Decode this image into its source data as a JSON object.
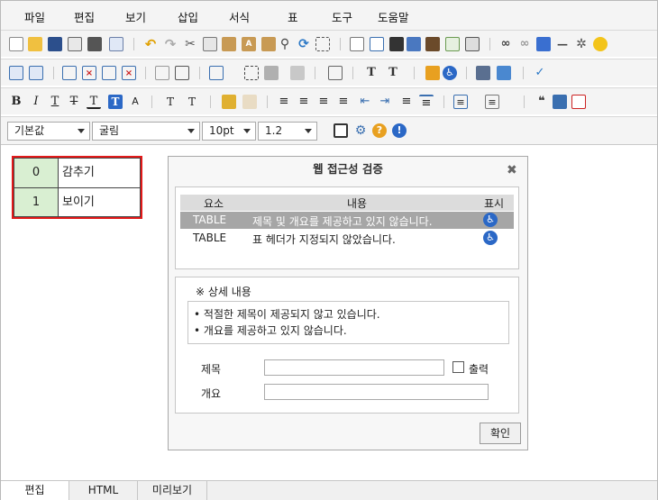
{
  "menu": [
    "파일",
    "편집",
    "보기",
    "삽입",
    "서식",
    "표",
    "도구",
    "도움말"
  ],
  "format_bar": {
    "style_value": "기본값",
    "font_value": "굴림",
    "size_value": "10pt",
    "line_height_value": "1.2"
  },
  "document_table": {
    "rows": [
      {
        "num": "0",
        "label": "감추기"
      },
      {
        "num": "1",
        "label": "보이기"
      }
    ]
  },
  "dialog": {
    "title": "웹 접근성 검증",
    "columns": {
      "element": "요소",
      "content": "내용",
      "display": "표시"
    },
    "results": [
      {
        "element": "TABLE",
        "content": "제목 및 개요를 제공하고 있지 않습니다."
      },
      {
        "element": "TABLE",
        "content": "표 헤더가 지정되지 않았습니다."
      }
    ],
    "details_header": "※ 상세 내용",
    "details": [
      "적절한 제목이 제공되지 않고 있습니다.",
      "개요를 제공하고 있지 않습니다."
    ],
    "title_label": "제목",
    "print_label": "출력",
    "summary_label": "개요",
    "ok_button": "확인"
  },
  "tabs": [
    "편집",
    "HTML",
    "미리보기"
  ]
}
